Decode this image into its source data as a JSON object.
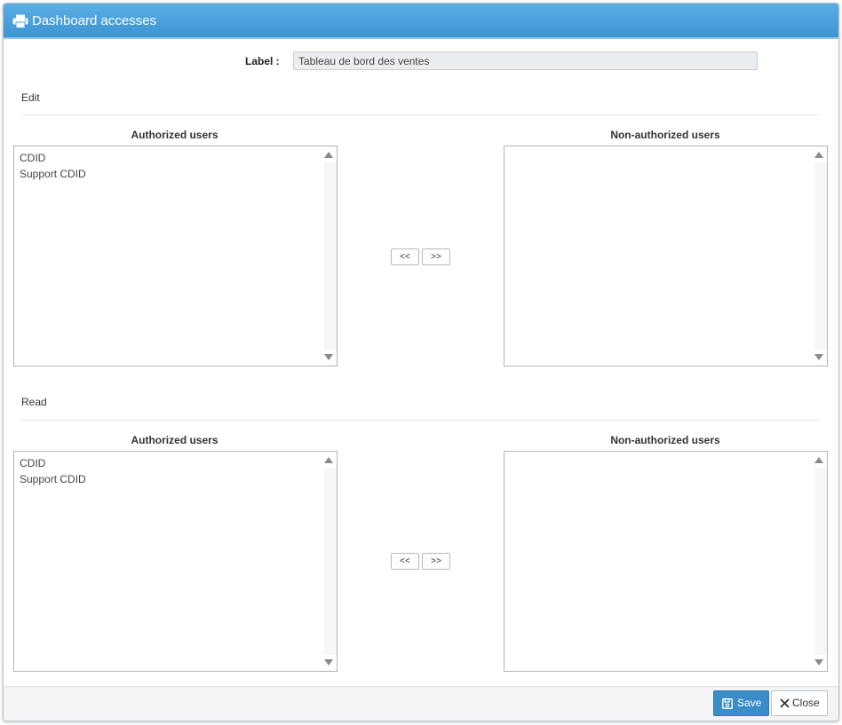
{
  "dialog": {
    "title": "Dashboard accesses",
    "title_icon": "printer-icon"
  },
  "form": {
    "label_caption": "Label :",
    "label_value": "Tableau de bord des ventes"
  },
  "sections": [
    {
      "title": "Edit",
      "authorized_header": "Authorized users",
      "non_authorized_header": "Non-authorized users",
      "authorized_users": [
        "CDID",
        "Support CDID"
      ],
      "non_authorized_users": [],
      "move_left_label": "<<",
      "move_right_label": ">>"
    },
    {
      "title": "Read",
      "authorized_header": "Authorized users",
      "non_authorized_header": "Non-authorized users",
      "authorized_users": [
        "CDID",
        "Support CDID"
      ],
      "non_authorized_users": [],
      "move_left_label": "<<",
      "move_right_label": ">>"
    }
  ],
  "footer": {
    "save_label": "Save",
    "save_icon": "floppy-disk-icon",
    "close_label": "Close",
    "close_icon": "close-icon"
  },
  "colors": {
    "header_blue": "#3d94d2",
    "save_button": "#3a8dc8"
  }
}
